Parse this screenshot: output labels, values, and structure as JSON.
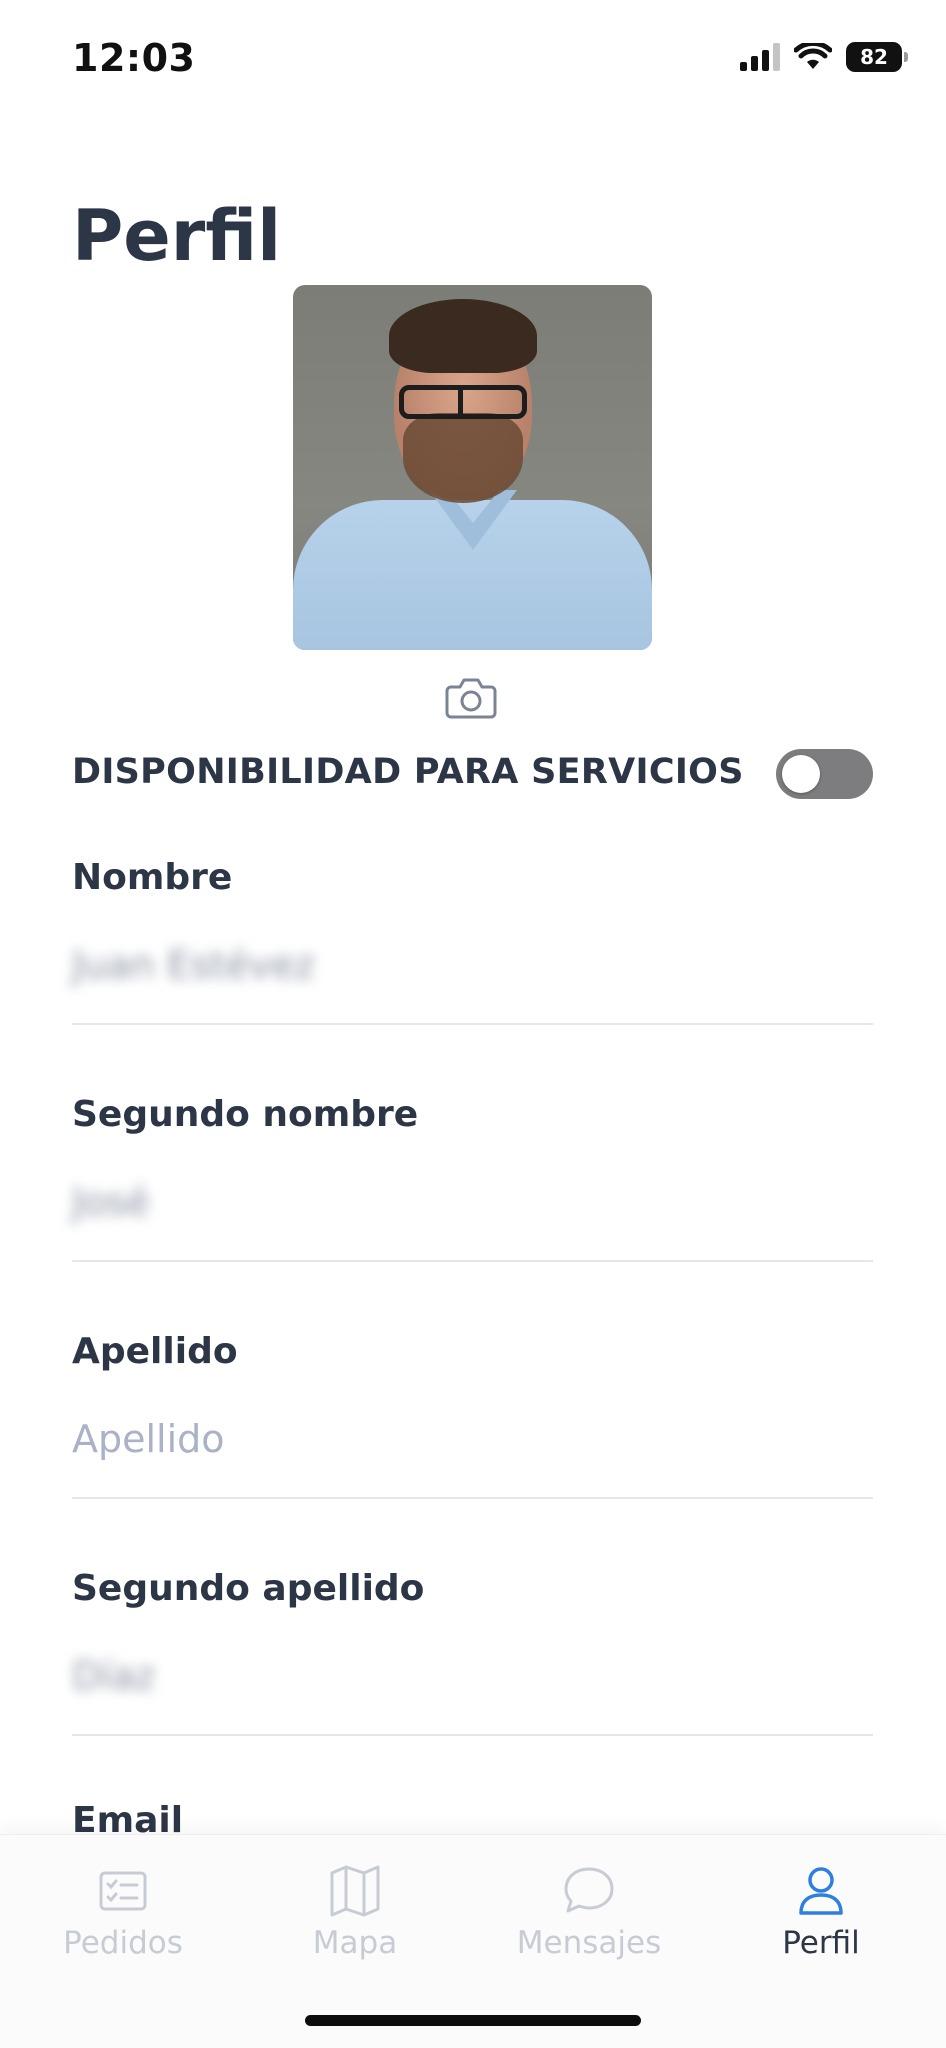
{
  "status_bar": {
    "time": "12:03",
    "battery": "82",
    "icons": [
      "cellular-signal-icon",
      "wifi-icon",
      "battery-icon"
    ]
  },
  "page": {
    "title": "Perfil"
  },
  "profile": {
    "photo_icon": "camera-icon",
    "availability_label": "DISPONIBILIDAD PARA SERVICIOS",
    "availability_enabled": false
  },
  "fields": {
    "nombre": {
      "label": "Nombre",
      "value": "Juan Estévez"
    },
    "segundo_nombre": {
      "label": "Segundo nombre",
      "value": "José"
    },
    "apellido": {
      "label": "Apellido",
      "placeholder": "Apellido",
      "value": ""
    },
    "segundo_apellido": {
      "label": "Segundo apellido",
      "value": "Díaz"
    },
    "email": {
      "label": "Email"
    }
  },
  "tab_bar": {
    "tabs": [
      {
        "label": "Pedidos",
        "icon": "checklist-icon",
        "active": false
      },
      {
        "label": "Mapa",
        "icon": "map-icon",
        "active": false
      },
      {
        "label": "Mensajes",
        "icon": "chat-bubble-icon",
        "active": false
      },
      {
        "label": "Perfil",
        "icon": "user-icon",
        "active": true
      }
    ]
  },
  "colors": {
    "text_primary": "#2c3646",
    "placeholder": "#a9b2c6",
    "tab_inactive": "#c7ccd4",
    "tab_active_icon": "#2f7fe0",
    "toggle_off": "#7d7d80"
  }
}
